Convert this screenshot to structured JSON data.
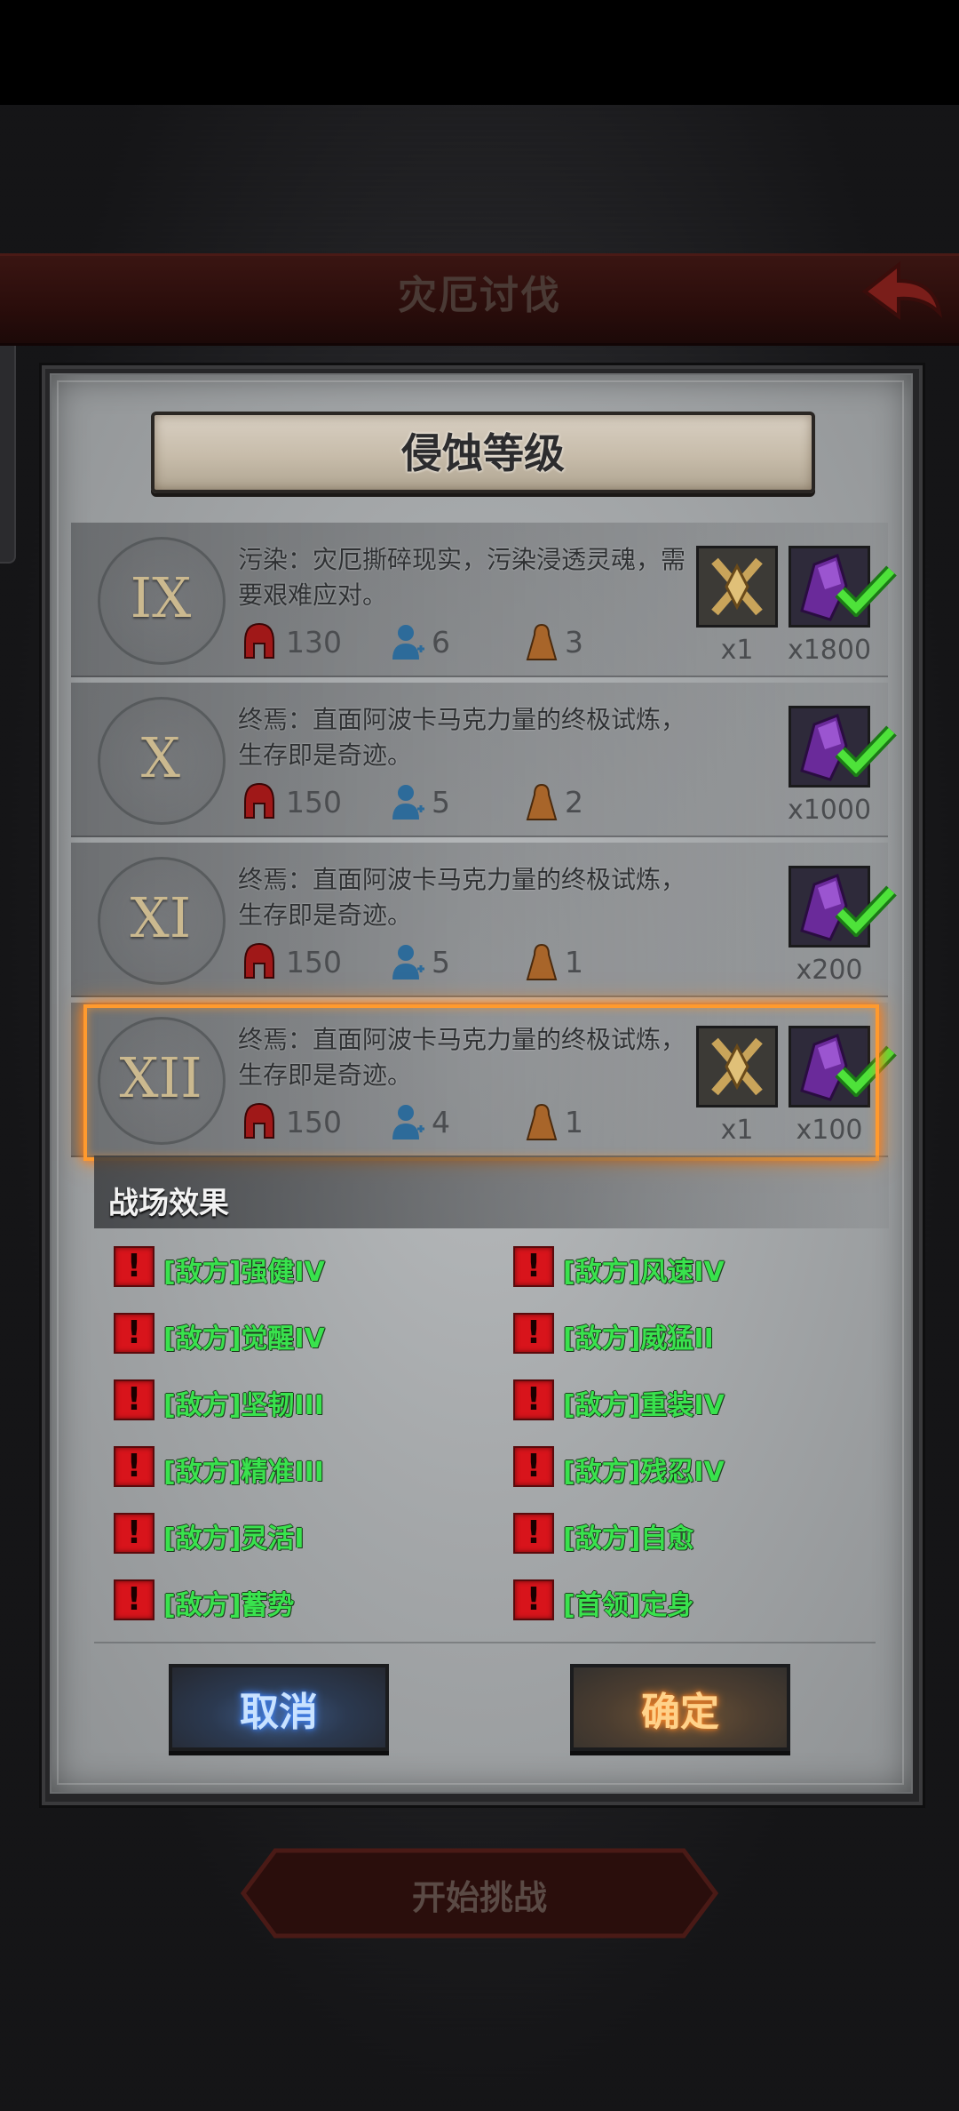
{
  "header": {
    "title": "灾厄讨伐"
  },
  "dialog": {
    "title": "侵蚀等级",
    "levels": [
      {
        "numeral": "IX",
        "desc": "污染：灾厄撕碎现实，污染浸透灵魂，需要艰难应对。",
        "stat_red": "130",
        "stat_blue": "6",
        "stat_orange": "3",
        "rewards": [
          {
            "item": "emblem-icon",
            "count": "x1"
          },
          {
            "item": "crystal-icon",
            "count": "x1800",
            "claimed": true
          }
        ]
      },
      {
        "numeral": "X",
        "desc": "终焉：直面阿波卡马克力量的终极试炼，生存即是奇迹。",
        "stat_red": "150",
        "stat_blue": "5",
        "stat_orange": "2",
        "rewards": [
          {
            "item": "crystal-icon",
            "count": "x1000",
            "claimed": true
          }
        ]
      },
      {
        "numeral": "XI",
        "desc": "终焉：直面阿波卡马克力量的终极试炼，生存即是奇迹。",
        "stat_red": "150",
        "stat_blue": "5",
        "stat_orange": "1",
        "rewards": [
          {
            "item": "crystal-icon",
            "count": "x200",
            "claimed": true
          }
        ]
      },
      {
        "numeral": "XII",
        "desc": "终焉：直面阿波卡马克力量的终极试炼，生存即是奇迹。",
        "stat_red": "150",
        "stat_blue": "4",
        "stat_orange": "1",
        "selected": true,
        "rewards": [
          {
            "item": "emblem-icon",
            "count": "x1"
          },
          {
            "item": "crystal-icon",
            "count": "x100",
            "claimed": true
          }
        ]
      }
    ],
    "effects_title": "战场效果",
    "effects_left": [
      "[敌方]强健IV",
      "[敌方]觉醒IV",
      "[敌方]坚韧III",
      "[敌方]精准III",
      "[敌方]灵活I",
      "[敌方]蓄势"
    ],
    "effects_right": [
      "[敌方]风速IV",
      "[敌方]威猛II",
      "[敌方]重装IV",
      "[敌方]残忍IV",
      "[敌方]自愈",
      "[首领]定身"
    ],
    "cancel_label": "取消",
    "confirm_label": "确定"
  },
  "footer": {
    "start_label": "开始挑战"
  },
  "colors": {
    "effect_text": "#39e24d",
    "selected_border": "#ff9a2e",
    "effect_icon": "#d8141b"
  }
}
